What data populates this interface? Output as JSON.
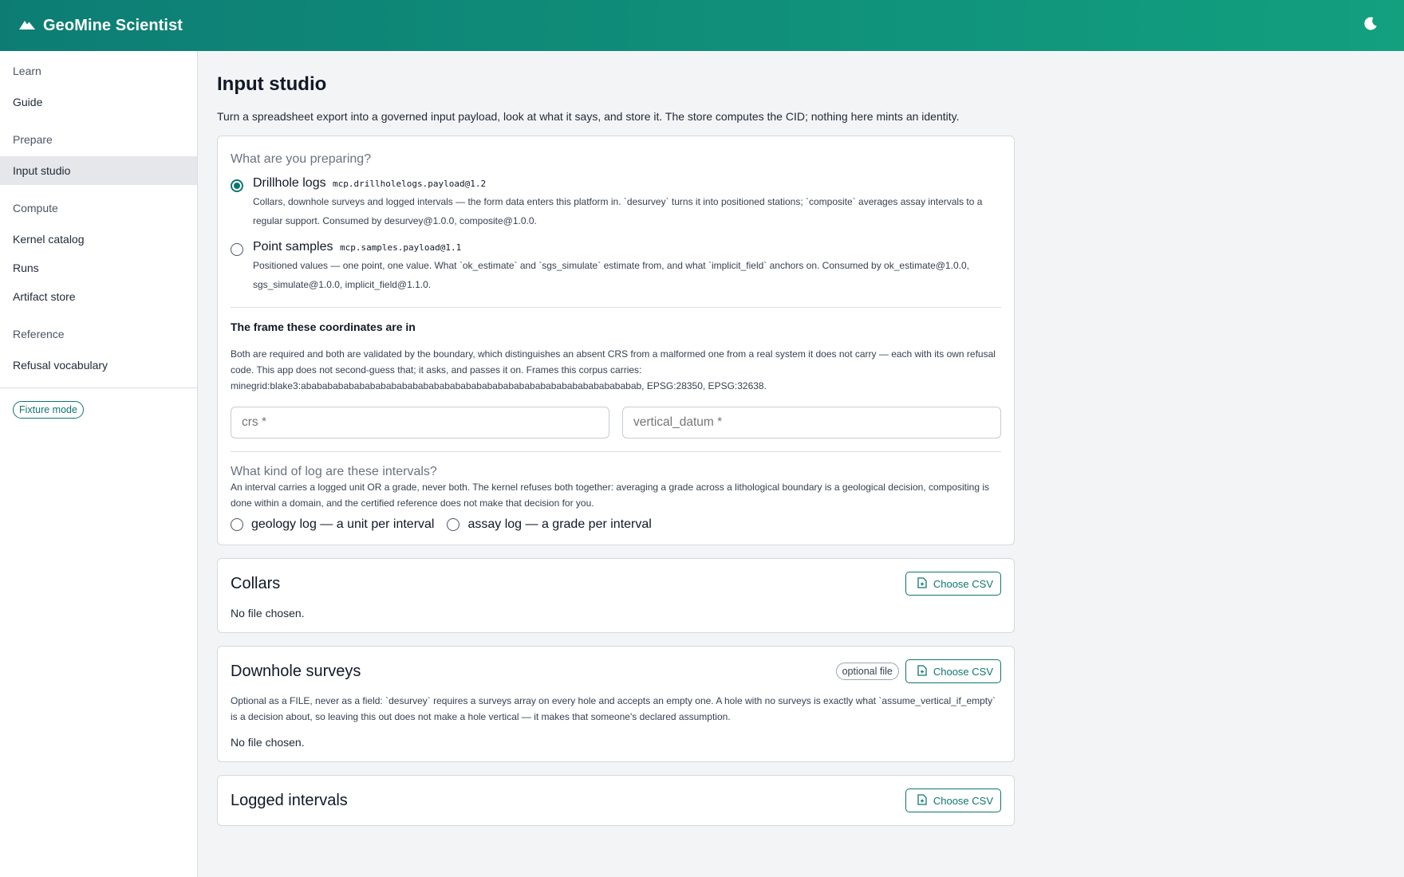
{
  "app": {
    "title": "GeoMine Scientist"
  },
  "sidebar": {
    "groups": [
      {
        "label": "Learn",
        "items": [
          "Guide"
        ]
      },
      {
        "label": "Prepare",
        "items": [
          "Input studio"
        ]
      },
      {
        "label": "Compute",
        "items": [
          "Kernel catalog",
          "Runs",
          "Artifact store"
        ]
      },
      {
        "label": "Reference",
        "items": [
          "Refusal vocabulary"
        ]
      }
    ],
    "active": "Input studio",
    "fixture_mode": "Fixture mode"
  },
  "page": {
    "title": "Input studio",
    "subtitle": "Turn a spreadsheet export into a governed input payload, look at what it says, and store it. The store computes the CID; nothing here mints an identity."
  },
  "prepare": {
    "heading": "What are you preparing?",
    "options": [
      {
        "title": "Drillhole logs",
        "code": "mcp.drillholelogs.payload@1.2",
        "desc": "Collars, downhole surveys and logged intervals — the form data enters this platform in. `desurvey` turns it into positioned stations; `composite` averages assay intervals to a regular support. Consumed by desurvey@1.0.0, composite@1.0.0.",
        "selected": true
      },
      {
        "title": "Point samples",
        "code": "mcp.samples.payload@1.1",
        "desc": "Positioned values — one point, one value. What `ok_estimate` and `sgs_simulate` estimate from, and what `implicit_field` anchors on. Consumed by ok_estimate@1.0.0, sgs_simulate@1.0.0, implicit_field@1.1.0.",
        "selected": false
      }
    ],
    "frame": {
      "heading": "The frame these coordinates are in",
      "desc": "Both are required and both are validated by the boundary, which distinguishes an absent CRS from a malformed one from a real system it does not carry — each with its own refusal code. This app does not second-guess that; it asks, and passes it on. Frames this corpus carries: minegrid:blake3:abababababababababababababababababababababababababababababababab, EPSG:28350, EPSG:32638.",
      "crs_placeholder": "crs *",
      "vdatum_placeholder": "vertical_datum *"
    },
    "logkind": {
      "heading": "What kind of log are these intervals?",
      "desc": "An interval carries a logged unit OR a grade, never both. The kernel refuses both together: averaging a grade across a lithological boundary is a geological decision, compositing is done within a domain, and the certified reference does not make that decision for you.",
      "options": [
        "geology log — a unit per interval",
        "assay log — a grade per interval"
      ]
    }
  },
  "files": [
    {
      "title": "Collars",
      "optional": "",
      "desc": "",
      "status": "No file chosen.",
      "button": "Choose CSV"
    },
    {
      "title": "Downhole surveys",
      "optional": "optional file",
      "desc": "Optional as a FILE, never as a field: `desurvey` requires a surveys array on every hole and accepts an empty one. A hole with no surveys is exactly what `assume_vertical_if_empty` is a decision about, so leaving this out does not make a hole vertical — it makes that someone's declared assumption.",
      "status": "No file chosen.",
      "button": "Choose CSV"
    },
    {
      "title": "Logged intervals",
      "optional": "",
      "desc": "",
      "status": "",
      "button": "Choose CSV"
    }
  ],
  "colors": {
    "accent": "#0f766e",
    "topbar_start": "#0d7d74",
    "topbar_end": "#12a07f"
  },
  "icons": {
    "brand": "mountain-icon",
    "theme": "moon-icon",
    "csv": "file-icon"
  }
}
